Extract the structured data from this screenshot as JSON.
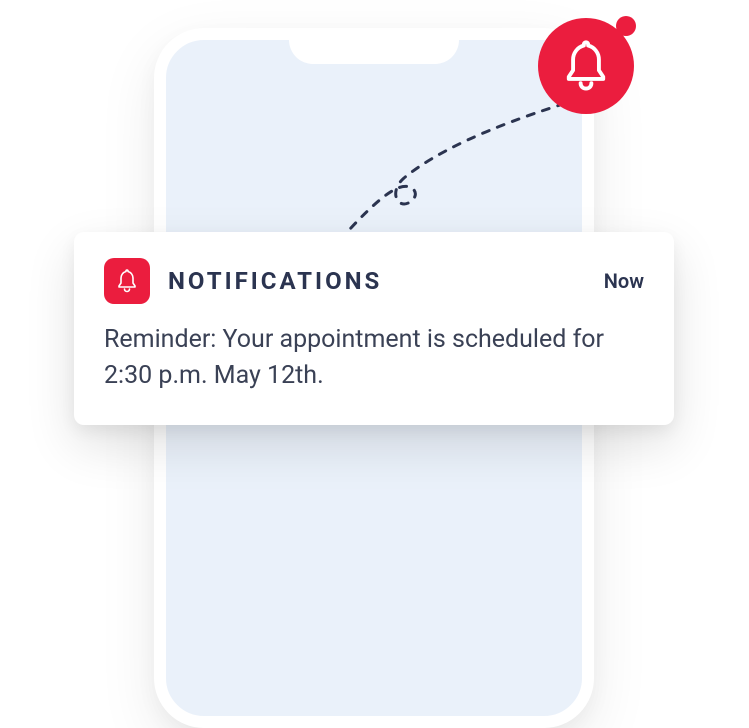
{
  "colors": {
    "accent": "#eb1d3e",
    "phone_screen": "#eaf1fa",
    "text_dark": "#2b3450"
  },
  "notification": {
    "app_name": "NOTIFICATIONS",
    "timestamp": "Now",
    "body": "Reminder: Your  appointment is scheduled for 2:30 p.m. May 12th."
  },
  "icons": {
    "bell_large": "bell-icon",
    "bell_small": "bell-icon"
  }
}
